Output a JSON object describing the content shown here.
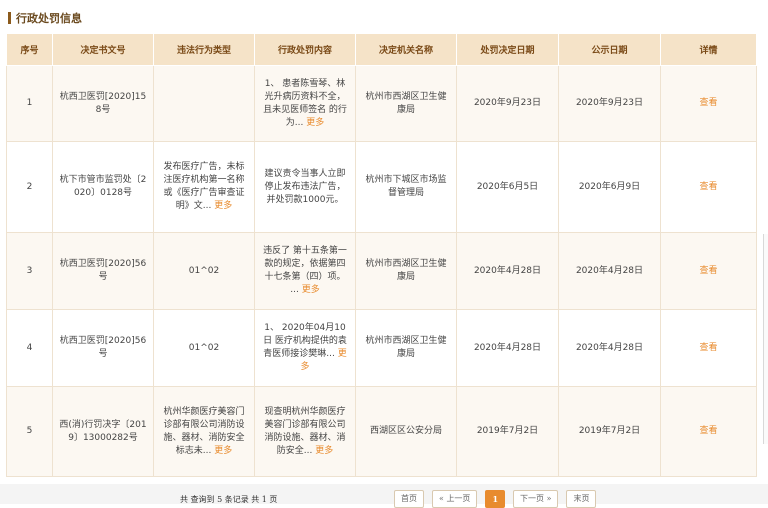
{
  "section": {
    "title": "行政处罚信息"
  },
  "table": {
    "headers": [
      "序号",
      "决定书文号",
      "违法行为类型",
      "行政处罚内容",
      "决定机关名称",
      "处罚决定日期",
      "公示日期",
      "详情"
    ],
    "more_label": "更多",
    "view_label": "查看",
    "rows": [
      {
        "no": "1",
        "doc": "杭西卫医罚[2020]158号",
        "type": "",
        "content": "1、 患者陈雪琴、林光升病历资料不全，且未见医师签名 的行为...",
        "agency": "杭州市西湖区卫生健康局",
        "decision_date": "2020年9月23日",
        "publish_date": "2020年9月23日"
      },
      {
        "no": "2",
        "doc": "杭下市管市监罚处〔2020〕0128号",
        "type": "发布医疗广告，未标注医疗机构第一名称或《医疗广告审查证明》文...",
        "content": "建议责令当事人立即停止发布违法广告，并处罚款1000元。",
        "agency": "杭州市下城区市场监督管理局",
        "decision_date": "2020年6月5日",
        "publish_date": "2020年6月9日"
      },
      {
        "no": "3",
        "doc": "杭西卫医罚[2020]56号",
        "type": "01^02",
        "content": "违反了 第十五条第一款的规定，依据第四十七条第（四）项。 ...",
        "agency": "杭州市西湖区卫生健康局",
        "decision_date": "2020年4月28日",
        "publish_date": "2020年4月28日"
      },
      {
        "no": "4",
        "doc": "杭西卫医罚[2020]56号",
        "type": "01^02",
        "content": "1、 2020年04月10日 医疗机构提供的袁青医师接诊樊琳...",
        "agency": "杭州市西湖区卫生健康局",
        "decision_date": "2020年4月28日",
        "publish_date": "2020年4月28日"
      },
      {
        "no": "5",
        "doc": "西(消)行罚决字〔2019〕13000282号",
        "type": "杭州华颜医疗美容门诊部有限公司消防设施、器材、消防安全标志未...",
        "content": "现查明杭州华颜医疗美容门诊部有限公司消防设施、器材、消防安全...",
        "agency": "西湖区区公安分局",
        "decision_date": "2019年7月2日",
        "publish_date": "2019年7月2日"
      }
    ]
  },
  "footer": {
    "record_info": "共 查询到 5 条记录 共 1 页",
    "pager": {
      "first": "首页",
      "prev": "« 上一页",
      "current": "1",
      "next": "下一页 »",
      "last": "末页"
    }
  }
}
